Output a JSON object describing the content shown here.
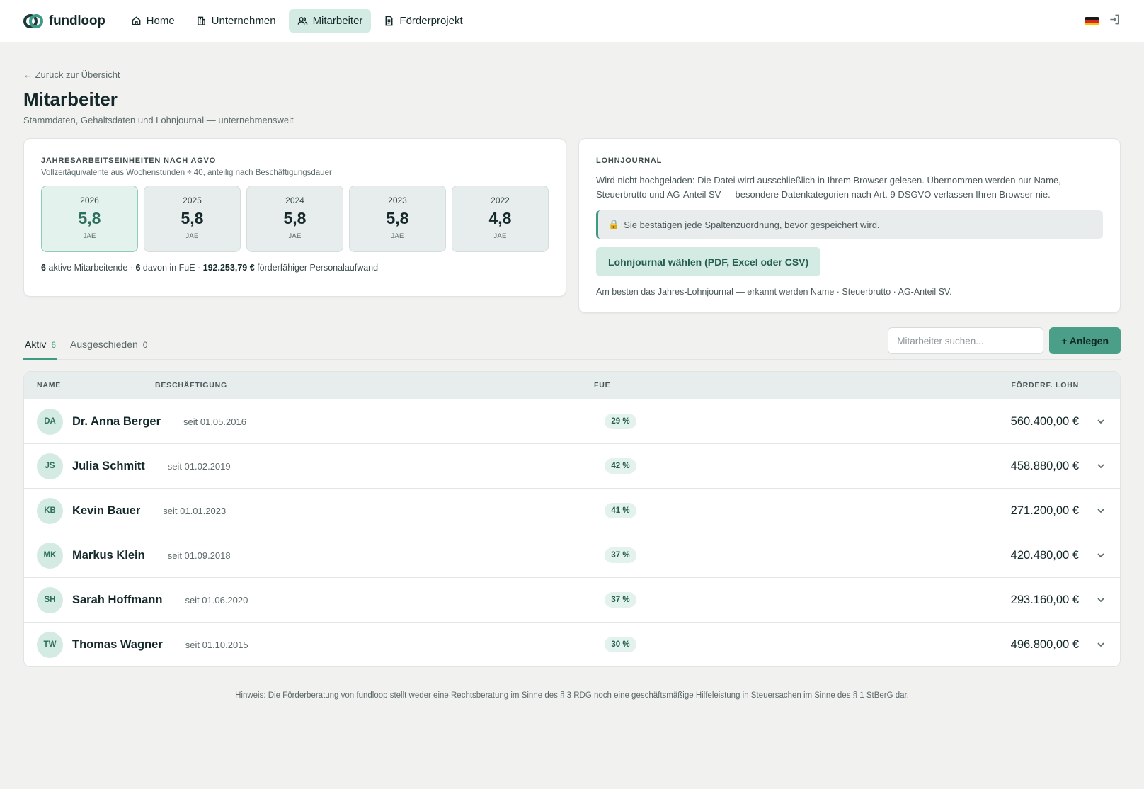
{
  "brand": {
    "name": "fundloop"
  },
  "nav": [
    {
      "label": "Home",
      "icon": "home-icon",
      "active": false
    },
    {
      "label": "Unternehmen",
      "icon": "building-icon",
      "active": false
    },
    {
      "label": "Mitarbeiter",
      "icon": "users-icon",
      "active": true
    },
    {
      "label": "Förderprojekt",
      "icon": "document-icon",
      "active": false
    }
  ],
  "topbar": {
    "language_flag": "flag-de-icon",
    "logout_icon": "logout-icon"
  },
  "back_link": "← Zurück zur Übersicht",
  "page": {
    "title": "Mitarbeiter",
    "subtitle": "Stammdaten, Gehaltsdaten und Lohnjournal — unternehmensweit"
  },
  "jae_card": {
    "label": "JAHRESARBEITSEINHEITEN NACH AGVO",
    "description": "Vollzeitäquivalente aus Wochenstunden ÷ 40, anteilig nach Beschäftigungsdauer",
    "years": [
      {
        "year": "2026",
        "value": "5,8",
        "unit": "JAE",
        "active": true
      },
      {
        "year": "2025",
        "value": "5,8",
        "unit": "JAE",
        "active": false
      },
      {
        "year": "2024",
        "value": "5,8",
        "unit": "JAE",
        "active": false
      },
      {
        "year": "2023",
        "value": "5,8",
        "unit": "JAE",
        "active": false
      },
      {
        "year": "2022",
        "value": "4,8",
        "unit": "JAE",
        "active": false
      }
    ],
    "summary": {
      "active_count": "6",
      "active_text": "aktive Mitarbeitende ·",
      "fue_count": "6",
      "fue_text": "davon in FuE ·",
      "amount": "192.253,79 €",
      "amount_text": "förderfähiger Personalaufwand"
    }
  },
  "lohnjournal": {
    "label": "LOHNJOURNAL",
    "text": "Wird nicht hochgeladen: Die Datei wird ausschließlich in Ihrem Browser gelesen. Übernommen werden nur Name, Steuerbrutto und AG-Anteil SV — besondere Datenkategorien nach Art. 9 DSGVO verlassen Ihren Browser nie.",
    "note": "Sie bestätigen jede Spaltenzuordnung, bevor gespeichert wird.",
    "button": "Lohnjournal wählen (PDF, Excel oder CSV)",
    "hint": "Am besten das Jahres-Lohnjournal — erkannt werden Name · Steuerbrutto · AG-Anteil SV."
  },
  "tabs": [
    {
      "label": "Aktiv",
      "count": "6",
      "active": true
    },
    {
      "label": "Ausgeschieden",
      "count": "0",
      "active": false
    }
  ],
  "search": {
    "placeholder": "Mitarbeiter suchen..."
  },
  "add_button": "+ Anlegen",
  "table": {
    "columns": [
      "NAME",
      "BESCHÄFTIGUNG",
      "FUE",
      "FÖRDERF. LOHN"
    ],
    "rows": [
      {
        "initials": "DA",
        "name": "Dr. Anna Berger",
        "since": "seit 01.05.2016",
        "fue": "29 %",
        "wage": "560.400,00 €"
      },
      {
        "initials": "JS",
        "name": "Julia Schmitt",
        "since": "seit 01.02.2019",
        "fue": "42 %",
        "wage": "458.880,00 €"
      },
      {
        "initials": "KB",
        "name": "Kevin Bauer",
        "since": "seit 01.01.2023",
        "fue": "41 %",
        "wage": "271.200,00 €"
      },
      {
        "initials": "MK",
        "name": "Markus Klein",
        "since": "seit 01.09.2018",
        "fue": "37 %",
        "wage": "420.480,00 €"
      },
      {
        "initials": "SH",
        "name": "Sarah Hoffmann",
        "since": "seit 01.06.2020",
        "fue": "37 %",
        "wage": "293.160,00 €"
      },
      {
        "initials": "TW",
        "name": "Thomas Wagner",
        "since": "seit 01.10.2015",
        "fue": "30 %",
        "wage": "496.800,00 €"
      }
    ]
  },
  "footer": {
    "note": "Hinweis: Die Förderberatung von fundloop stellt weder eine Rechtsberatung im Sinne des § 3 RDG noch eine geschäftsmäßige Hilfeleistung in Steuersachen im Sinne des § 1 StBerG dar."
  },
  "colors": {
    "accent": "#3f9a85",
    "accent_soft": "#d4ebe3",
    "primary_button": "#4b9e88",
    "text": "#14282a"
  }
}
